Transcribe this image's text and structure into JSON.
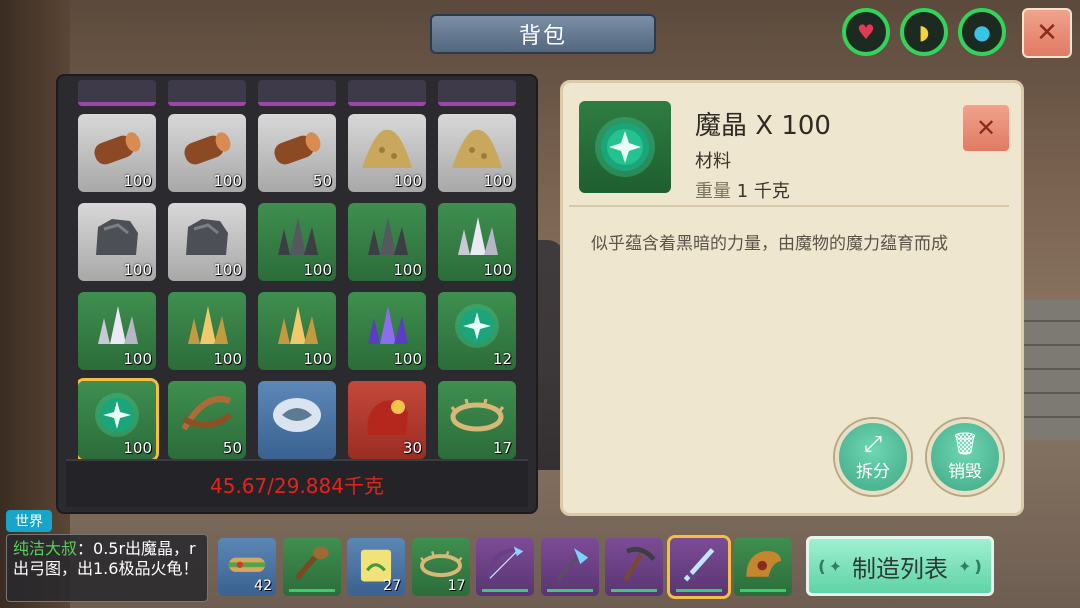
{
  "header": {
    "title": "背包"
  },
  "stats": [
    {
      "icon": "heart-icon",
      "glyph": "♥",
      "color": "#e03a55"
    },
    {
      "icon": "food-icon",
      "glyph": "◗",
      "color": "#f3d23a"
    },
    {
      "icon": "water-icon",
      "glyph": "●",
      "color": "#39c3e6"
    }
  ],
  "colors": {
    "accent": "#32d35a",
    "weight_red": "#e5231c",
    "select_gold": "#f3c042"
  },
  "inventory": {
    "slots": [
      {
        "item": "log",
        "count": "100"
      },
      {
        "item": "log",
        "count": "100"
      },
      {
        "item": "log",
        "count": "50"
      },
      {
        "item": "sand",
        "count": "100"
      },
      {
        "item": "sand",
        "count": "100"
      },
      {
        "item": "stone-ore",
        "count": "100"
      },
      {
        "item": "stone-ore",
        "count": "100"
      },
      {
        "item": "dark-crystal",
        "count": "100"
      },
      {
        "item": "dark-crystal",
        "count": "100"
      },
      {
        "item": "white-crystal",
        "count": "100"
      },
      {
        "item": "white-crystal",
        "count": "100"
      },
      {
        "item": "gold-crystal",
        "count": "100"
      },
      {
        "item": "gold-crystal",
        "count": "100"
      },
      {
        "item": "purple-crystal",
        "count": "100"
      },
      {
        "item": "magic-crystal",
        "count": "12"
      },
      {
        "item": "magic-crystal",
        "count": "100"
      },
      {
        "item": "bark-strips",
        "count": "50"
      },
      {
        "item": "feather-stone",
        "count": ""
      },
      {
        "item": "red-pouch",
        "count": "30"
      },
      {
        "item": "thorn-wreath",
        "count": "17"
      }
    ],
    "weight": "45.67/29.884千克"
  },
  "detail": {
    "name": "魔晶 X 100",
    "category": "材料",
    "weight_label": "重量",
    "weight_value": "1 千克",
    "description": "似乎蕴含着黑暗的力量，由魔物的魔力蕴育而成",
    "split_label": "拆分",
    "destroy_label": "销毁"
  },
  "chat": {
    "channel": "世界",
    "sender": "纯洁大叔",
    "message": "：0.5r出魔晶，r出弓图，出1.6极品火龟！"
  },
  "hotbar": {
    "slots": [
      {
        "item": "sandwich",
        "count": "42"
      },
      {
        "item": "club",
        "count": ""
      },
      {
        "item": "seed-bag",
        "count": "27"
      },
      {
        "item": "thorn-wreath",
        "count": "17"
      },
      {
        "item": "crystal-bow",
        "count": ""
      },
      {
        "item": "crystal-axe",
        "count": ""
      },
      {
        "item": "pickaxe",
        "count": ""
      },
      {
        "item": "crystal-sword",
        "count": ""
      },
      {
        "item": "horn-flask",
        "count": ""
      }
    ],
    "craft_label": "制造列表"
  }
}
